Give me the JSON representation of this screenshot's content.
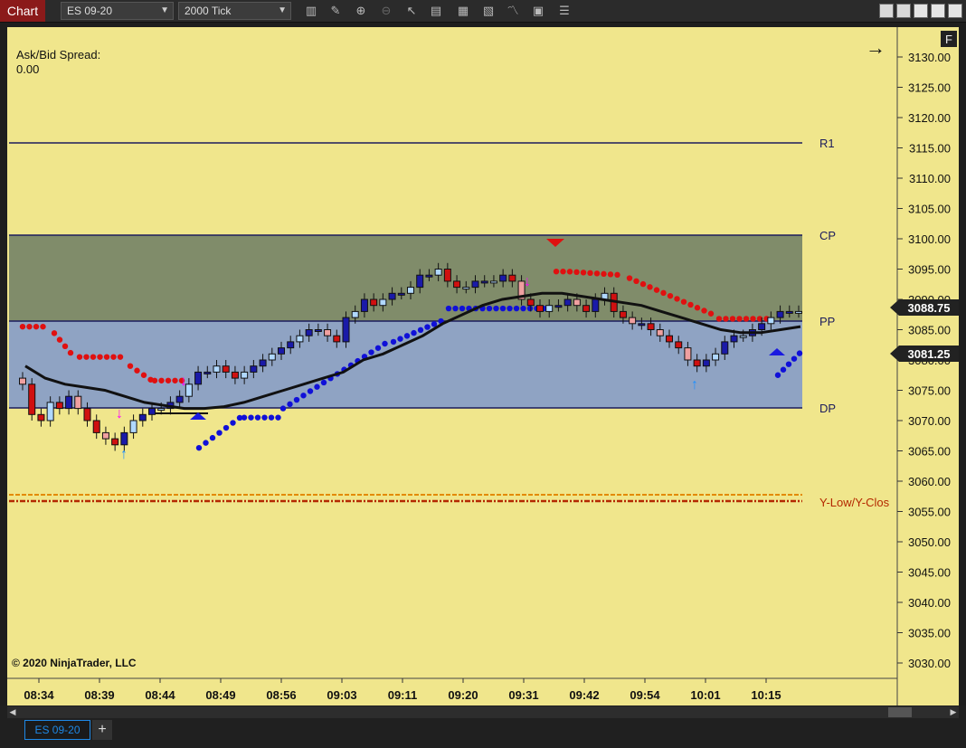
{
  "toolbar": {
    "chart_label": "Chart",
    "instrument": "ES 09-20",
    "interval": "2000 Tick",
    "icons": [
      "bar-type-icon",
      "draw-tool-icon",
      "zoom-in-icon",
      "zoom-out-icon",
      "pointer-icon",
      "properties-icon",
      "templates-icon",
      "indicators-icon",
      "strategies-icon",
      "data-box-icon",
      "attach-icon"
    ]
  },
  "chart": {
    "spread_label": "Ask/Bid Spread:",
    "spread_value": "0.00",
    "copyright": "© 2020 NinjaTrader, LLC",
    "f_badge": "F",
    "arrow_glyph": "→",
    "price_ticks": [
      "3130.00",
      "3125.00",
      "3120.00",
      "3115.00",
      "3110.00",
      "3105.00",
      "3100.00",
      "3095.00",
      "3090.00",
      "3085.00",
      "3080.00",
      "3075.00",
      "3070.00",
      "3065.00",
      "3060.00",
      "3055.00",
      "3050.00",
      "3045.00",
      "3040.00",
      "3035.00",
      "3030.00"
    ],
    "time_ticks": [
      "08:34",
      "08:39",
      "08:44",
      "08:49",
      "08:56",
      "09:03",
      "09:11",
      "09:20",
      "09:31",
      "09:42",
      "09:54",
      "10:01",
      "10:15"
    ],
    "last_price": "3088.75",
    "marker_price": "3081.25",
    "levels": {
      "r1": "R1",
      "cp": "CP",
      "pp": "PP",
      "dp": "DP",
      "ylow": "Y-Low/Y-Clos"
    },
    "colors": {
      "background": "#f0e68c",
      "cp_band": "#808c6a",
      "pp_band": "#8fa3c3",
      "up_bar": "#1a1aa8",
      "down_bar": "#d01010",
      "red_dots": "#e01010",
      "blue_dots": "#1010d8",
      "ylow": "#b42800"
    }
  },
  "chart_data": {
    "type": "candlestick",
    "ylim": [
      3028,
      3133
    ],
    "levels": [
      {
        "name": "R1",
        "y": 3116.0
      },
      {
        "name": "CP",
        "y": 3100.8
      },
      {
        "name": "PP",
        "y": 3086.6
      },
      {
        "name": "DP",
        "y": 3072.3
      },
      {
        "name": "Y-Low/Y-Clos",
        "y": 3057.2
      }
    ],
    "close_series": [
      3076,
      3071,
      3070,
      3073,
      3072,
      3074,
      3072,
      3070,
      3068,
      3067,
      3066,
      3068,
      3070,
      3071,
      3072,
      3072,
      3073,
      3074,
      3076,
      3078,
      3078,
      3079,
      3078,
      3077,
      3078,
      3079,
      3080,
      3081,
      3082,
      3083,
      3084,
      3085,
      3085,
      3084,
      3083,
      3087,
      3088,
      3090,
      3089,
      3090,
      3091,
      3091,
      3092,
      3094,
      3094,
      3095,
      3093,
      3092,
      3092,
      3093,
      3093,
      3093,
      3094,
      3093,
      3090,
      3089,
      3088,
      3089,
      3089,
      3090,
      3089,
      3088,
      3090,
      3091,
      3088,
      3087,
      3086,
      3086,
      3085,
      3084,
      3083,
      3082,
      3080,
      3079,
      3080,
      3081,
      3083,
      3084,
      3084,
      3085,
      3086,
      3087,
      3088,
      3088,
      3088
    ],
    "sma_series": [
      3079,
      3077,
      3076,
      3075.5,
      3075,
      3074,
      3073,
      3072.5,
      3072,
      3072,
      3072.3,
      3073,
      3074,
      3075,
      3076,
      3077,
      3078,
      3080,
      3081,
      3082.5,
      3084,
      3086,
      3087.5,
      3089,
      3090,
      3090.5,
      3091,
      3091,
      3090.5,
      3090,
      3089.5,
      3089,
      3088,
      3087,
      3086,
      3085,
      3084.5,
      3084.5,
      3085,
      3085.5
    ]
  }
}
